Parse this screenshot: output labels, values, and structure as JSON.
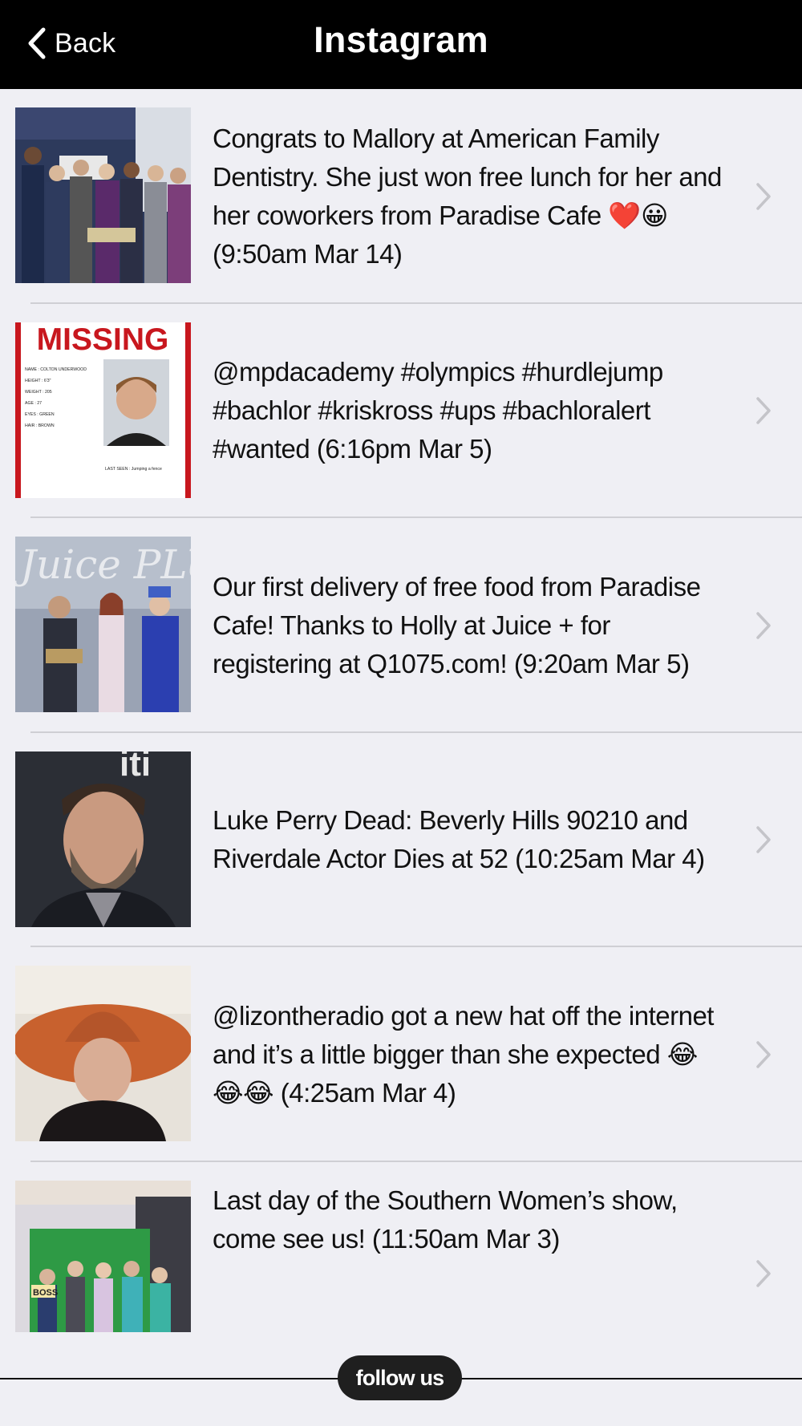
{
  "navbar": {
    "back_label": "Back",
    "title": "Instagram"
  },
  "posts": [
    {
      "caption": "Congrats to Mallory at American Family Dentistry. She just won free lunch for her and her coworkers from Paradise Cafe ❤️😀 (9:50am Mar 14)"
    },
    {
      "caption": "@mpdacademy #olympics #hurdlejump #bachlor #kriskross #ups #bachloralert #wanted (6:16pm Mar 5)",
      "image_text": "MISSING",
      "image_lines": [
        "NAME : COLTON UNDERWOOD",
        "HEIGHT : 6'3\"",
        "WEIGHT : 205",
        "AGE : 27",
        "EYES : GREEN",
        "HAIR : BROWN"
      ],
      "image_footer": "LAST SEEN : Jumping a fence"
    },
    {
      "caption": "Our first delivery of free food from Paradise Cafe! Thanks to Holly at Juice + for registering at Q1075.com! (9:20am Mar 5)",
      "image_text": "Juice PLUS"
    },
    {
      "caption": "Luke Perry Dead: Beverly Hills 90210 and Riverdale Actor Dies at 52 (10:25am Mar 4)",
      "image_text": "iti"
    },
    {
      "caption": "@lizontheradio got a new hat off the internet and it’s a little bigger than she expected 😂😂😂 (4:25am Mar 4)"
    },
    {
      "caption": "Last day of the Southern Women’s show, come see us! (11:50am Mar 3)",
      "image_text": "BOSS"
    }
  ],
  "footer": {
    "follow_label": "follow us"
  },
  "colors": {
    "navbar": "#000000",
    "background": "#efeff4",
    "separator": "#cfcfd4",
    "chevron": "#c4c4c9",
    "follow_button": "#1f1f1f"
  }
}
